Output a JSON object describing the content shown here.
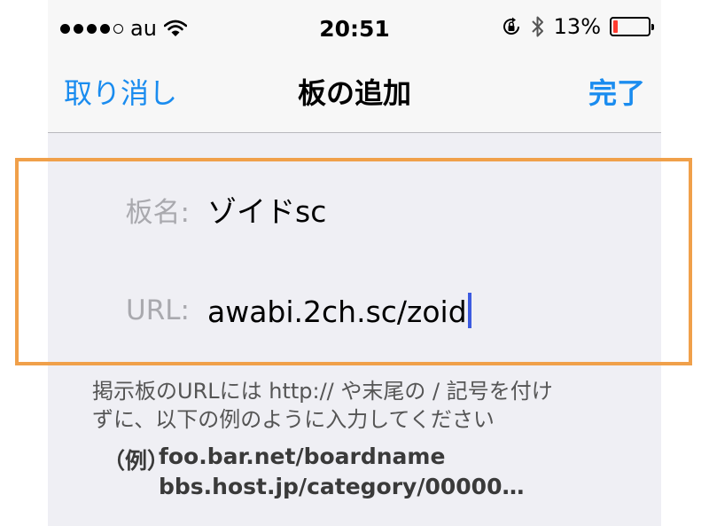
{
  "status_bar": {
    "signal_dots": [
      true,
      true,
      true,
      true,
      false
    ],
    "carrier": "au",
    "wifi_icon": "wifi-icon",
    "time": "20:51",
    "rotation_lock_icon": "rotation-lock-icon",
    "bluetooth_icon": "bluetooth-icon",
    "battery_percent": "13%",
    "battery_level": 0.13,
    "battery_color": "#ff3b30"
  },
  "nav": {
    "cancel_label": "取り消し",
    "title": "板の追加",
    "done_label": "完了",
    "accent_color": "#1a8cef"
  },
  "form": {
    "board_name": {
      "label": "板名:",
      "value": "ゾイドsc"
    },
    "url": {
      "label": "URL:",
      "value": "awabi.2ch.sc/zoid"
    }
  },
  "hint": {
    "line1": "掲示板のURLには http:// や末尾の / 記号を付け",
    "line2": "ずに、以下の例のように入力してください"
  },
  "example": {
    "label": "（例）",
    "lines": [
      "foo.bar.net/boardname",
      "bbs.host.jp/category/00000…"
    ]
  },
  "highlight_color": "#f0a04a"
}
